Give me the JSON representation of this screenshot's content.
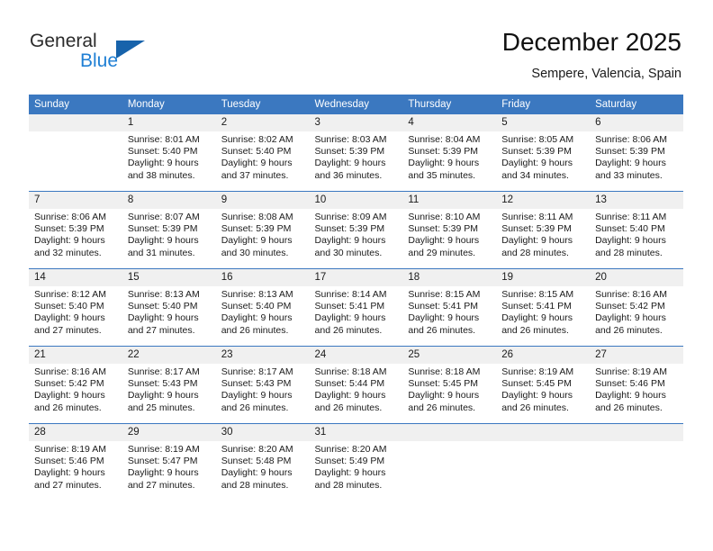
{
  "brand": {
    "name_part1": "General",
    "name_part2": "Blue",
    "triangle_icon": "triangle-icon",
    "colors": {
      "dark": "#2b2b2b",
      "blue": "#1f7fd4",
      "triangle": "#1763ab"
    }
  },
  "header": {
    "title": "December 2025",
    "subtitle": "Sempere, Valencia, Spain"
  },
  "theme": {
    "header_row_bg": "#3b78c0",
    "daynum_bg": "#f0f0f0",
    "row_divider": "#3b78c0",
    "text": "#1a1a1a"
  },
  "weekday_headers": [
    "Sunday",
    "Monday",
    "Tuesday",
    "Wednesday",
    "Thursday",
    "Friday",
    "Saturday"
  ],
  "labels": {
    "sunrise_prefix": "Sunrise:",
    "sunset_prefix": "Sunset:",
    "daylight_prefix": "Daylight:"
  },
  "weeks": [
    [
      {
        "day": "",
        "blank": true
      },
      {
        "day": "1",
        "sunrise": "Sunrise: 8:01 AM",
        "sunset": "Sunset: 5:40 PM",
        "daylight_1": "Daylight: 9 hours",
        "daylight_2": "and 38 minutes."
      },
      {
        "day": "2",
        "sunrise": "Sunrise: 8:02 AM",
        "sunset": "Sunset: 5:40 PM",
        "daylight_1": "Daylight: 9 hours",
        "daylight_2": "and 37 minutes."
      },
      {
        "day": "3",
        "sunrise": "Sunrise: 8:03 AM",
        "sunset": "Sunset: 5:39 PM",
        "daylight_1": "Daylight: 9 hours",
        "daylight_2": "and 36 minutes."
      },
      {
        "day": "4",
        "sunrise": "Sunrise: 8:04 AM",
        "sunset": "Sunset: 5:39 PM",
        "daylight_1": "Daylight: 9 hours",
        "daylight_2": "and 35 minutes."
      },
      {
        "day": "5",
        "sunrise": "Sunrise: 8:05 AM",
        "sunset": "Sunset: 5:39 PM",
        "daylight_1": "Daylight: 9 hours",
        "daylight_2": "and 34 minutes."
      },
      {
        "day": "6",
        "sunrise": "Sunrise: 8:06 AM",
        "sunset": "Sunset: 5:39 PM",
        "daylight_1": "Daylight: 9 hours",
        "daylight_2": "and 33 minutes."
      }
    ],
    [
      {
        "day": "7",
        "sunrise": "Sunrise: 8:06 AM",
        "sunset": "Sunset: 5:39 PM",
        "daylight_1": "Daylight: 9 hours",
        "daylight_2": "and 32 minutes."
      },
      {
        "day": "8",
        "sunrise": "Sunrise: 8:07 AM",
        "sunset": "Sunset: 5:39 PM",
        "daylight_1": "Daylight: 9 hours",
        "daylight_2": "and 31 minutes."
      },
      {
        "day": "9",
        "sunrise": "Sunrise: 8:08 AM",
        "sunset": "Sunset: 5:39 PM",
        "daylight_1": "Daylight: 9 hours",
        "daylight_2": "and 30 minutes."
      },
      {
        "day": "10",
        "sunrise": "Sunrise: 8:09 AM",
        "sunset": "Sunset: 5:39 PM",
        "daylight_1": "Daylight: 9 hours",
        "daylight_2": "and 30 minutes."
      },
      {
        "day": "11",
        "sunrise": "Sunrise: 8:10 AM",
        "sunset": "Sunset: 5:39 PM",
        "daylight_1": "Daylight: 9 hours",
        "daylight_2": "and 29 minutes."
      },
      {
        "day": "12",
        "sunrise": "Sunrise: 8:11 AM",
        "sunset": "Sunset: 5:39 PM",
        "daylight_1": "Daylight: 9 hours",
        "daylight_2": "and 28 minutes."
      },
      {
        "day": "13",
        "sunrise": "Sunrise: 8:11 AM",
        "sunset": "Sunset: 5:40 PM",
        "daylight_1": "Daylight: 9 hours",
        "daylight_2": "and 28 minutes."
      }
    ],
    [
      {
        "day": "14",
        "sunrise": "Sunrise: 8:12 AM",
        "sunset": "Sunset: 5:40 PM",
        "daylight_1": "Daylight: 9 hours",
        "daylight_2": "and 27 minutes."
      },
      {
        "day": "15",
        "sunrise": "Sunrise: 8:13 AM",
        "sunset": "Sunset: 5:40 PM",
        "daylight_1": "Daylight: 9 hours",
        "daylight_2": "and 27 minutes."
      },
      {
        "day": "16",
        "sunrise": "Sunrise: 8:13 AM",
        "sunset": "Sunset: 5:40 PM",
        "daylight_1": "Daylight: 9 hours",
        "daylight_2": "and 26 minutes."
      },
      {
        "day": "17",
        "sunrise": "Sunrise: 8:14 AM",
        "sunset": "Sunset: 5:41 PM",
        "daylight_1": "Daylight: 9 hours",
        "daylight_2": "and 26 minutes."
      },
      {
        "day": "18",
        "sunrise": "Sunrise: 8:15 AM",
        "sunset": "Sunset: 5:41 PM",
        "daylight_1": "Daylight: 9 hours",
        "daylight_2": "and 26 minutes."
      },
      {
        "day": "19",
        "sunrise": "Sunrise: 8:15 AM",
        "sunset": "Sunset: 5:41 PM",
        "daylight_1": "Daylight: 9 hours",
        "daylight_2": "and 26 minutes."
      },
      {
        "day": "20",
        "sunrise": "Sunrise: 8:16 AM",
        "sunset": "Sunset: 5:42 PM",
        "daylight_1": "Daylight: 9 hours",
        "daylight_2": "and 26 minutes."
      }
    ],
    [
      {
        "day": "21",
        "sunrise": "Sunrise: 8:16 AM",
        "sunset": "Sunset: 5:42 PM",
        "daylight_1": "Daylight: 9 hours",
        "daylight_2": "and 26 minutes."
      },
      {
        "day": "22",
        "sunrise": "Sunrise: 8:17 AM",
        "sunset": "Sunset: 5:43 PM",
        "daylight_1": "Daylight: 9 hours",
        "daylight_2": "and 25 minutes."
      },
      {
        "day": "23",
        "sunrise": "Sunrise: 8:17 AM",
        "sunset": "Sunset: 5:43 PM",
        "daylight_1": "Daylight: 9 hours",
        "daylight_2": "and 26 minutes."
      },
      {
        "day": "24",
        "sunrise": "Sunrise: 8:18 AM",
        "sunset": "Sunset: 5:44 PM",
        "daylight_1": "Daylight: 9 hours",
        "daylight_2": "and 26 minutes."
      },
      {
        "day": "25",
        "sunrise": "Sunrise: 8:18 AM",
        "sunset": "Sunset: 5:45 PM",
        "daylight_1": "Daylight: 9 hours",
        "daylight_2": "and 26 minutes."
      },
      {
        "day": "26",
        "sunrise": "Sunrise: 8:19 AM",
        "sunset": "Sunset: 5:45 PM",
        "daylight_1": "Daylight: 9 hours",
        "daylight_2": "and 26 minutes."
      },
      {
        "day": "27",
        "sunrise": "Sunrise: 8:19 AM",
        "sunset": "Sunset: 5:46 PM",
        "daylight_1": "Daylight: 9 hours",
        "daylight_2": "and 26 minutes."
      }
    ],
    [
      {
        "day": "28",
        "sunrise": "Sunrise: 8:19 AM",
        "sunset": "Sunset: 5:46 PM",
        "daylight_1": "Daylight: 9 hours",
        "daylight_2": "and 27 minutes."
      },
      {
        "day": "29",
        "sunrise": "Sunrise: 8:19 AM",
        "sunset": "Sunset: 5:47 PM",
        "daylight_1": "Daylight: 9 hours",
        "daylight_2": "and 27 minutes."
      },
      {
        "day": "30",
        "sunrise": "Sunrise: 8:20 AM",
        "sunset": "Sunset: 5:48 PM",
        "daylight_1": "Daylight: 9 hours",
        "daylight_2": "and 28 minutes."
      },
      {
        "day": "31",
        "sunrise": "Sunrise: 8:20 AM",
        "sunset": "Sunset: 5:49 PM",
        "daylight_1": "Daylight: 9 hours",
        "daylight_2": "and 28 minutes."
      },
      {
        "day": "",
        "blank": true
      },
      {
        "day": "",
        "blank": true
      },
      {
        "day": "",
        "blank": true
      }
    ]
  ]
}
